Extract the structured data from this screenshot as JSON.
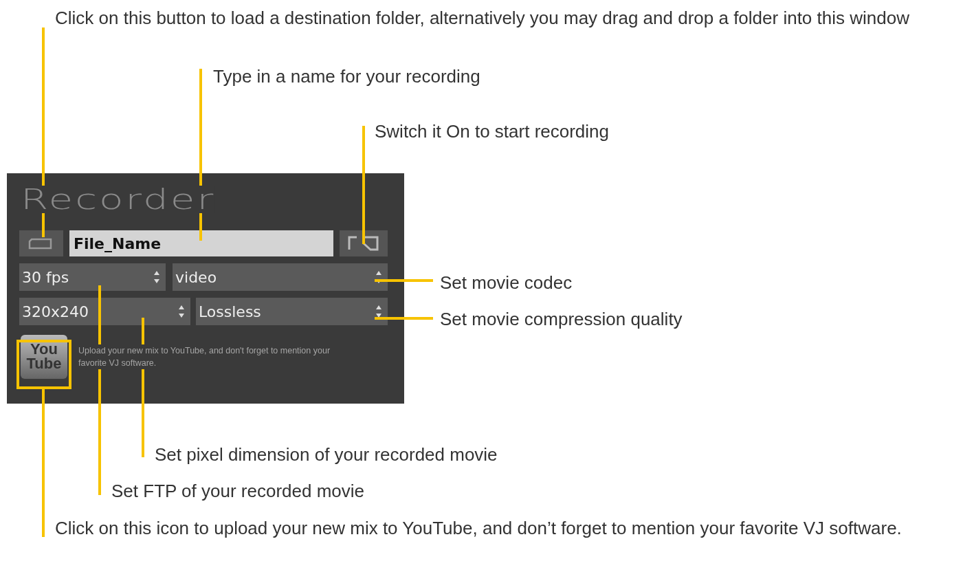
{
  "recorder": {
    "title": "Recorder",
    "file_name": {
      "value": "File_Name"
    },
    "selects": [
      {
        "value": "30 fps"
      },
      {
        "value": "video"
      },
      {
        "value": "320x240"
      },
      {
        "value": "Lossless"
      }
    ],
    "youtube_logo": [
      "You",
      "Tube"
    ],
    "youtube_text": "Upload your new mix to YouTube, and don't forget to mention your favorite VJ software."
  },
  "annotations": [
    {
      "text": "Click on this button to load a destination folder, alternatively you may drag and drop a folder into this window"
    },
    {
      "text": "Type in a name for your recording"
    },
    {
      "text": "Switch it On to start recording"
    },
    {
      "text": "Set movie codec"
    },
    {
      "text": "Set movie compression quality"
    },
    {
      "text": "Set pixel dimension of your recorded movie"
    },
    {
      "text": "Set FTP of your recorded movie"
    },
    {
      "text": "Click on this icon to upload your new mix to YouTube, and don’t forget to mention your favorite VJ software."
    }
  ]
}
